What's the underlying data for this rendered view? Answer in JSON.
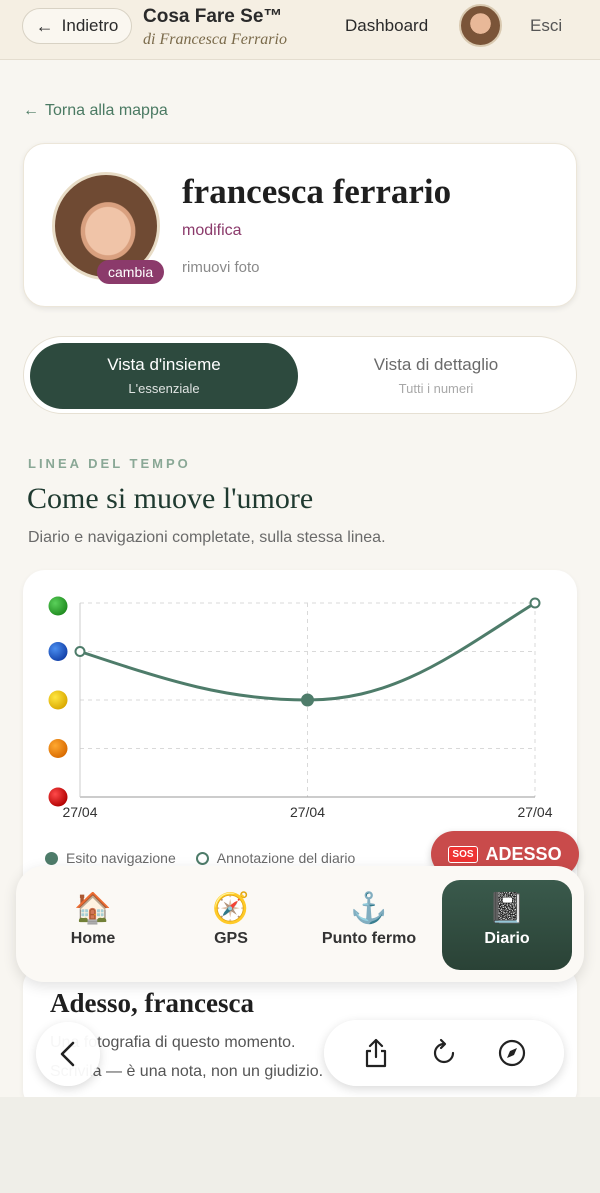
{
  "header": {
    "back_label": "Indietro",
    "brand_title": "Cosa Fare Se™",
    "brand_subtitle": "di Francesca Ferrario",
    "nav_dashboard": "Dashboard",
    "nav_logout": "Esci"
  },
  "back_to_map": "Torna alla mappa",
  "profile": {
    "name": "francesca ferrario",
    "edit_link": "modifica",
    "change_photo": "cambia",
    "remove_photo": "rimuovi foto"
  },
  "view_toggle": [
    {
      "label": "Vista d'insieme",
      "sub": "L'essenziale",
      "active": true
    },
    {
      "label": "Vista di dettaglio",
      "sub": "Tutti i numeri",
      "active": false
    }
  ],
  "timeline": {
    "kicker": "LINEA DEL TEMPO",
    "title": "Come si muove l'umore",
    "description": "Diario e navigazioni completate, sulla stessa linea."
  },
  "chart_data": {
    "type": "line",
    "x": [
      "27/04",
      "27/04",
      "27/04"
    ],
    "y_scale_markers": [
      "green",
      "blue",
      "yellow",
      "orange",
      "red"
    ],
    "ylim": [
      1,
      5
    ],
    "series": [
      {
        "name": "Esito navigazione",
        "values": [
          null,
          3,
          null
        ],
        "marker": "filled"
      },
      {
        "name": "Annotazione del diario",
        "values": [
          4,
          null,
          5
        ],
        "marker": "hollow"
      }
    ],
    "line_values": [
      4,
      3,
      5
    ],
    "grid": true,
    "legend_position": "bottom",
    "colors": {
      "line": "#4e7c6a",
      "grid": "#d9d9d9"
    }
  },
  "sos": {
    "badge": "SOS",
    "label": "ADESSO"
  },
  "tabs": [
    {
      "label": "Home",
      "icon": "🏠",
      "active": false
    },
    {
      "label": "GPS",
      "icon": "🧭",
      "active": false
    },
    {
      "label": "Punto fermo",
      "icon": "⚓",
      "active": false
    },
    {
      "label": "Diario",
      "icon": "📓",
      "active": true
    }
  ],
  "adesso": {
    "title": "Adesso, francesca",
    "line1": "Una fotografia di questo momento.",
    "line2": "Scrivila — è una nota, non un giudizio."
  }
}
